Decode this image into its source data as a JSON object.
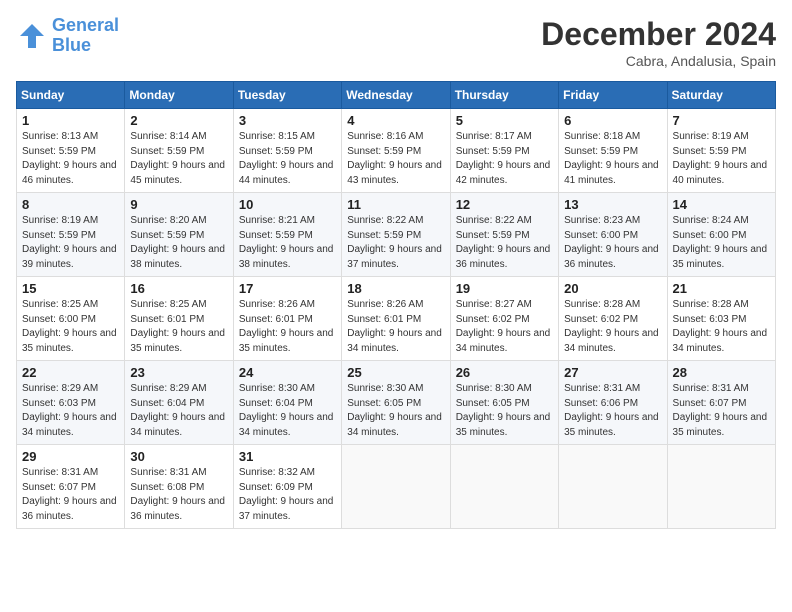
{
  "header": {
    "logo_general": "General",
    "logo_blue": "Blue",
    "month": "December 2024",
    "location": "Cabra, Andalusia, Spain"
  },
  "weekdays": [
    "Sunday",
    "Monday",
    "Tuesday",
    "Wednesday",
    "Thursday",
    "Friday",
    "Saturday"
  ],
  "weeks": [
    [
      {
        "day": 1,
        "sunrise": "8:13 AM",
        "sunset": "5:59 PM",
        "daylight": "9 hours and 46 minutes."
      },
      {
        "day": 2,
        "sunrise": "8:14 AM",
        "sunset": "5:59 PM",
        "daylight": "9 hours and 45 minutes."
      },
      {
        "day": 3,
        "sunrise": "8:15 AM",
        "sunset": "5:59 PM",
        "daylight": "9 hours and 44 minutes."
      },
      {
        "day": 4,
        "sunrise": "8:16 AM",
        "sunset": "5:59 PM",
        "daylight": "9 hours and 43 minutes."
      },
      {
        "day": 5,
        "sunrise": "8:17 AM",
        "sunset": "5:59 PM",
        "daylight": "9 hours and 42 minutes."
      },
      {
        "day": 6,
        "sunrise": "8:18 AM",
        "sunset": "5:59 PM",
        "daylight": "9 hours and 41 minutes."
      },
      {
        "day": 7,
        "sunrise": "8:19 AM",
        "sunset": "5:59 PM",
        "daylight": "9 hours and 40 minutes."
      }
    ],
    [
      {
        "day": 8,
        "sunrise": "8:19 AM",
        "sunset": "5:59 PM",
        "daylight": "9 hours and 39 minutes."
      },
      {
        "day": 9,
        "sunrise": "8:20 AM",
        "sunset": "5:59 PM",
        "daylight": "9 hours and 38 minutes."
      },
      {
        "day": 10,
        "sunrise": "8:21 AM",
        "sunset": "5:59 PM",
        "daylight": "9 hours and 38 minutes."
      },
      {
        "day": 11,
        "sunrise": "8:22 AM",
        "sunset": "5:59 PM",
        "daylight": "9 hours and 37 minutes."
      },
      {
        "day": 12,
        "sunrise": "8:22 AM",
        "sunset": "5:59 PM",
        "daylight": "9 hours and 36 minutes."
      },
      {
        "day": 13,
        "sunrise": "8:23 AM",
        "sunset": "6:00 PM",
        "daylight": "9 hours and 36 minutes."
      },
      {
        "day": 14,
        "sunrise": "8:24 AM",
        "sunset": "6:00 PM",
        "daylight": "9 hours and 35 minutes."
      }
    ],
    [
      {
        "day": 15,
        "sunrise": "8:25 AM",
        "sunset": "6:00 PM",
        "daylight": "9 hours and 35 minutes."
      },
      {
        "day": 16,
        "sunrise": "8:25 AM",
        "sunset": "6:01 PM",
        "daylight": "9 hours and 35 minutes."
      },
      {
        "day": 17,
        "sunrise": "8:26 AM",
        "sunset": "6:01 PM",
        "daylight": "9 hours and 35 minutes."
      },
      {
        "day": 18,
        "sunrise": "8:26 AM",
        "sunset": "6:01 PM",
        "daylight": "9 hours and 34 minutes."
      },
      {
        "day": 19,
        "sunrise": "8:27 AM",
        "sunset": "6:02 PM",
        "daylight": "9 hours and 34 minutes."
      },
      {
        "day": 20,
        "sunrise": "8:28 AM",
        "sunset": "6:02 PM",
        "daylight": "9 hours and 34 minutes."
      },
      {
        "day": 21,
        "sunrise": "8:28 AM",
        "sunset": "6:03 PM",
        "daylight": "9 hours and 34 minutes."
      }
    ],
    [
      {
        "day": 22,
        "sunrise": "8:29 AM",
        "sunset": "6:03 PM",
        "daylight": "9 hours and 34 minutes."
      },
      {
        "day": 23,
        "sunrise": "8:29 AM",
        "sunset": "6:04 PM",
        "daylight": "9 hours and 34 minutes."
      },
      {
        "day": 24,
        "sunrise": "8:30 AM",
        "sunset": "6:04 PM",
        "daylight": "9 hours and 34 minutes."
      },
      {
        "day": 25,
        "sunrise": "8:30 AM",
        "sunset": "6:05 PM",
        "daylight": "9 hours and 34 minutes."
      },
      {
        "day": 26,
        "sunrise": "8:30 AM",
        "sunset": "6:05 PM",
        "daylight": "9 hours and 35 minutes."
      },
      {
        "day": 27,
        "sunrise": "8:31 AM",
        "sunset": "6:06 PM",
        "daylight": "9 hours and 35 minutes."
      },
      {
        "day": 28,
        "sunrise": "8:31 AM",
        "sunset": "6:07 PM",
        "daylight": "9 hours and 35 minutes."
      }
    ],
    [
      {
        "day": 29,
        "sunrise": "8:31 AM",
        "sunset": "6:07 PM",
        "daylight": "9 hours and 36 minutes."
      },
      {
        "day": 30,
        "sunrise": "8:31 AM",
        "sunset": "6:08 PM",
        "daylight": "9 hours and 36 minutes."
      },
      {
        "day": 31,
        "sunrise": "8:32 AM",
        "sunset": "6:09 PM",
        "daylight": "9 hours and 37 minutes."
      },
      null,
      null,
      null,
      null
    ]
  ]
}
